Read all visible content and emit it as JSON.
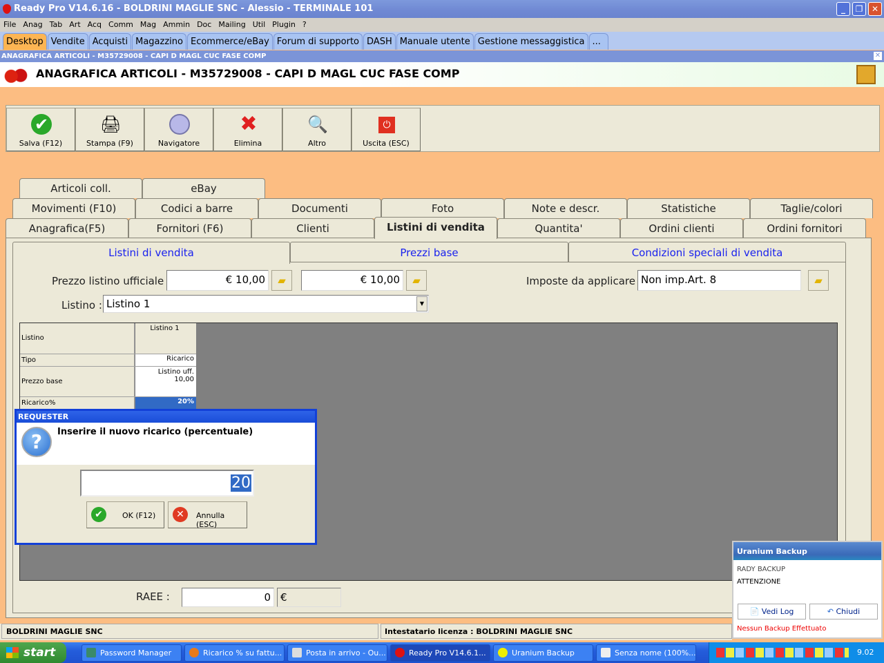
{
  "window": {
    "title": "Ready Pro V14.6.16 - BOLDRINI MAGLIE SNC - Alessio - TERMINALE 101"
  },
  "menu": [
    "File",
    "Anag",
    "Tab",
    "Art",
    "Acq",
    "Comm",
    "Mag",
    "Ammin",
    "Doc",
    "Mailing",
    "Util",
    "Plugin",
    "?"
  ],
  "module_tabs": [
    "Desktop",
    "Vendite",
    "Acquisti",
    "Magazzino",
    "Ecommerce/eBay",
    "Forum di supporto",
    "DASH",
    "Manuale utente",
    "Gestione messaggistica",
    "..."
  ],
  "doc_bar": "ANAGRAFICA ARTICOLI - M35729008 - CAPI D MAGL CUC FASE COMP",
  "header_title": "ANAGRAFICA ARTICOLI - M35729008 - CAPI D MAGL CUC FASE COMP",
  "toolbar": [
    {
      "label": "Salva (F12)",
      "icon": "check-icon"
    },
    {
      "label": "Stampa (F9)",
      "icon": "printer-icon"
    },
    {
      "label": "Navigatore",
      "icon": "compass-icon"
    },
    {
      "label": "Elimina",
      "icon": "delete-x-icon"
    },
    {
      "label": "Altro",
      "icon": "magnifier-book-icon"
    },
    {
      "label": "Uscita (ESC)",
      "icon": "power-icon"
    }
  ],
  "tabs_row3": [
    "Articoli coll.",
    "eBay"
  ],
  "tabs_row2": [
    "Movimenti (F10)",
    "Codici a barre",
    "Documenti",
    "Foto",
    "Note e descr.",
    "Statistiche",
    "Taglie/colori"
  ],
  "tabs_row1": [
    "Anagrafica(F5)",
    "Fornitori (F6)",
    "Clienti",
    "Listini di vendita",
    "Quantita'",
    "Ordini clienti",
    "Ordini fornitori"
  ],
  "subtabs": [
    "Listini di vendita",
    "Prezzi base",
    "Condizioni speciali di vendita"
  ],
  "form": {
    "prezzo_label": "Prezzo listino ufficiale :",
    "prezzo1": "€ 10,00",
    "prezzo2": "€ 10,00",
    "imposte_label": "Imposte da applicare :",
    "imposte": "Non imp.Art. 8",
    "listino_label": "Listino :",
    "listino": "Listino 1",
    "raee_label": "RAEE :",
    "raee": "0",
    "raee_currency": "€"
  },
  "grid": {
    "column": "Listino 1",
    "rows": [
      {
        "label": "Listino",
        "value": ""
      },
      {
        "label": "Tipo",
        "value": "Ricarico"
      },
      {
        "label": "Prezzo base",
        "value": "Listino uff.",
        "value2": "10,00"
      },
      {
        "label": "Ricarico%",
        "value": "20%"
      }
    ]
  },
  "dialog": {
    "title": "REQUESTER",
    "message": "Inserire il nuovo ricarico (percentuale)",
    "value": "20",
    "ok": "OK (F12)",
    "cancel": "Annulla (ESC)"
  },
  "status": {
    "left": "BOLDRINI MAGLIE SNC",
    "right": "Intestatario licenza : BOLDRINI MAGLIE SNC"
  },
  "uranium": {
    "title": "Uranium Backup",
    "line1": "RADY BACKUP",
    "line2": "ATTENZIONE",
    "log": "Vedi Log",
    "close": "Chiudi",
    "warning": "Nessun Backup Effettuato"
  },
  "taskbar": {
    "start": "start",
    "items": [
      "Password Manager",
      "Ricarico % su fattu...",
      "Posta in arrivo - Ou...",
      "Ready Pro V14.6.1...",
      "Uranium Backup",
      "Senza nome (100%..."
    ],
    "clock": "9.02"
  },
  "colors": {
    "accent": "#1240d8",
    "selected": "#316ac5"
  }
}
